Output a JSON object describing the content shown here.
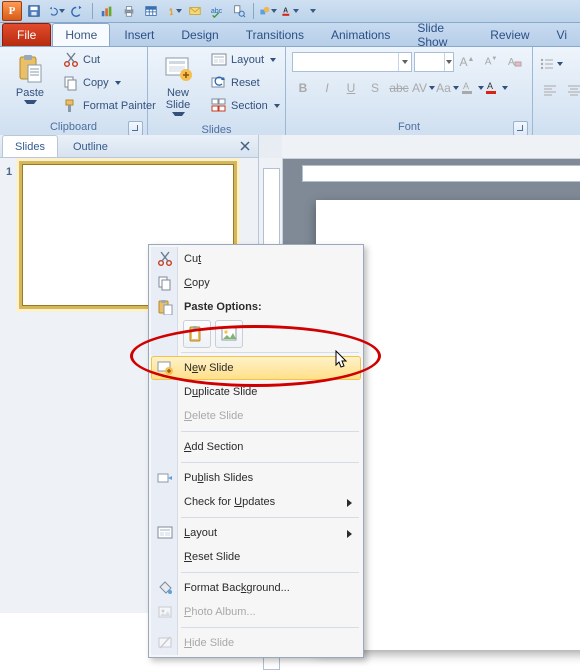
{
  "qat": {
    "icons": [
      "save-icon",
      "undo-icon",
      "redo-icon",
      "chart-icon",
      "print-quick-icon",
      "table-icon",
      "touch-icon",
      "email-icon",
      "spell-icon",
      "research-icon",
      "shapes-icon",
      "more-icon",
      "font-color-icon"
    ]
  },
  "tabs": {
    "file": "File",
    "items": [
      "Home",
      "Insert",
      "Design",
      "Transitions",
      "Animations",
      "Slide Show",
      "Review",
      "Vi"
    ],
    "selected": 0
  },
  "ribbon": {
    "clipboard": {
      "title": "Clipboard",
      "paste": "Paste",
      "cut": "Cut",
      "copy": "Copy",
      "format_painter": "Format Painter"
    },
    "slides": {
      "title": "Slides",
      "new_slide": "New\nSlide",
      "layout": "Layout",
      "reset": "Reset",
      "section": "Section"
    },
    "font": {
      "title": "Font",
      "b": "B",
      "i": "I",
      "u": "U",
      "s": "S",
      "family_placeholder": "",
      "size_placeholder": ""
    }
  },
  "leftpane": {
    "tab_slides": "Slides",
    "tab_outline": "Outline",
    "slide_numbers": [
      "1"
    ]
  },
  "context_menu": {
    "cut": "Cut",
    "copy": "Copy",
    "paste_options": "Paste Options:",
    "new_slide_pre": "N",
    "new_slide_u": "e",
    "new_slide_post": "w Slide",
    "duplicate_pre": "D",
    "duplicate_u": "u",
    "duplicate_post": "plicate Slide",
    "delete_pre": "",
    "delete_u": "D",
    "delete_post": "elete Slide",
    "add_section_pre": "",
    "add_section_u": "A",
    "add_section_post": "dd Section",
    "publish_pre": "Pu",
    "publish_u": "b",
    "publish_post": "lish Slides",
    "check_updates_pre": "Check for ",
    "check_updates_u": "U",
    "check_updates_post": "pdates",
    "layout_pre": "",
    "layout_u": "L",
    "layout_post": "ayout",
    "reset_pre": "",
    "reset_u": "R",
    "reset_post": "eset Slide",
    "format_bg_pre": "Format Bac",
    "format_bg_u": "k",
    "format_bg_post": "ground...",
    "photo_album_pre": "",
    "photo_album_u": "P",
    "photo_album_post": "hoto Album...",
    "hide_pre": "",
    "hide_u": "H",
    "hide_post": "ide Slide"
  }
}
